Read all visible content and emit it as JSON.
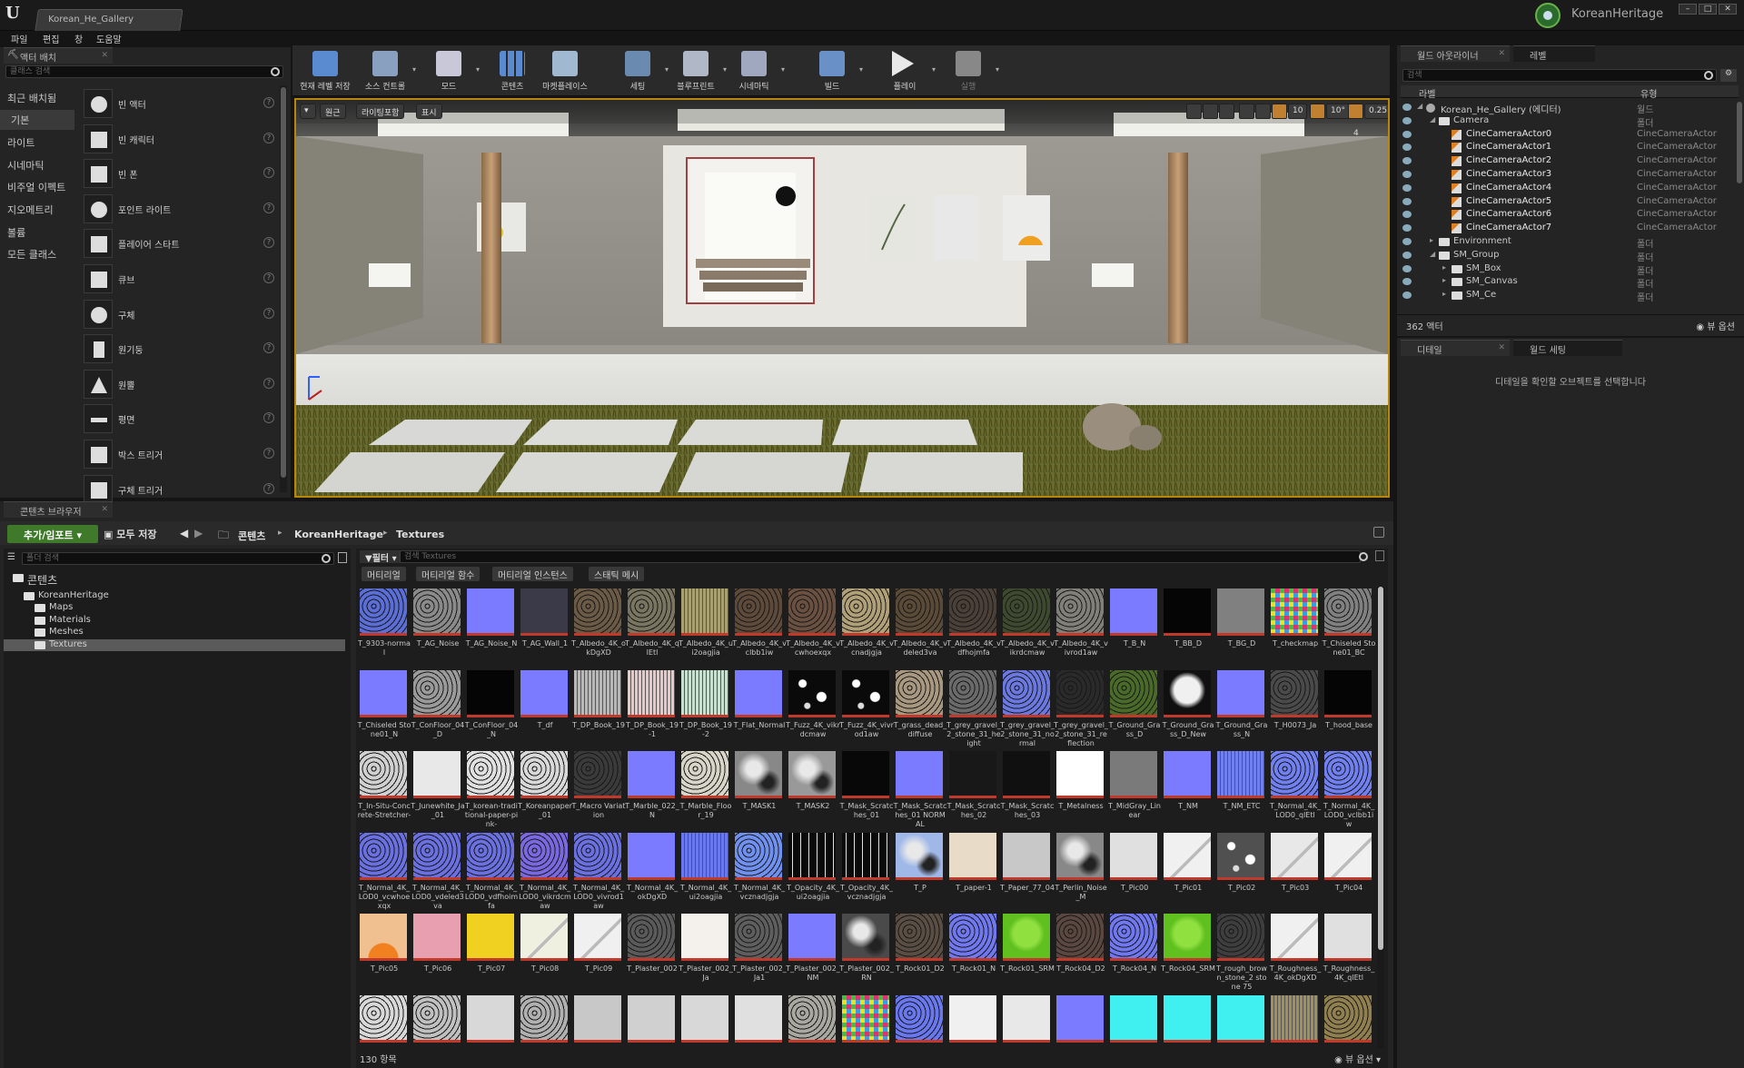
{
  "app": {
    "tab_title": "Korean_He_Gallery",
    "project_name": "KoreanHeritage"
  },
  "menu": [
    "파일",
    "편집",
    "창",
    "도움말"
  ],
  "place_actors": {
    "tab": "액터 배치",
    "search_placeholder": "클래스 검색",
    "categories": [
      "최근 배치됨",
      "기본",
      "라이트",
      "시네마틱",
      "비주얼 이펙트",
      "지오메트리",
      "볼륨",
      "모든 클래스"
    ],
    "active_category": "기본",
    "items": [
      "빈 액터",
      "빈 캐릭터",
      "빈 폰",
      "포인트 라이트",
      "플레이어 스타트",
      "큐브",
      "구체",
      "원기둥",
      "원뿔",
      "평면",
      "박스 트리거",
      "구체 트리거"
    ]
  },
  "toolbar": [
    {
      "label": "현재 레벨 저장",
      "icon": "save-icon",
      "caret": false
    },
    {
      "label": "소스 컨트롤",
      "icon": "source-control-icon",
      "caret": true
    },
    {
      "label": "모드",
      "icon": "modes-icon",
      "caret": true
    },
    {
      "label": "콘텐츠",
      "icon": "content-icon",
      "caret": false
    },
    {
      "label": "마켓플레이스",
      "icon": "marketplace-icon",
      "caret": false
    },
    {
      "label": "세팅",
      "icon": "settings-icon",
      "caret": true
    },
    {
      "label": "블루프린트",
      "icon": "blueprint-icon",
      "caret": true
    },
    {
      "label": "시네마틱",
      "icon": "cinematics-icon",
      "caret": true
    },
    {
      "label": "빌드",
      "icon": "build-icon",
      "caret": true
    },
    {
      "label": "플레이",
      "icon": "play-icon",
      "caret": true
    },
    {
      "label": "실행",
      "icon": "launch-icon",
      "caret": true
    }
  ],
  "viewport": {
    "perspective": "원근",
    "lit": "라이팅포함",
    "show": "표시",
    "grid_snap": "10",
    "rot_snap": "10°",
    "scale_snap": "0.25",
    "cam_speed": "4"
  },
  "outliner": {
    "tab": "월드 아웃라이너",
    "tab2": "레벨",
    "search_placeholder": "검색",
    "col_label": "라벨",
    "col_type": "유형",
    "rows": [
      {
        "label": "Korean_He_Gallery (에디터)",
        "type": "월드",
        "indent": 0,
        "icon": "world-icon"
      },
      {
        "label": "Camera",
        "type": "폴더",
        "indent": 1,
        "icon": "folder-icon"
      },
      {
        "label": "CineCameraActor0",
        "type": "CineCameraActor",
        "indent": 2,
        "icon": "camera-icon"
      },
      {
        "label": "CineCameraActor1",
        "type": "CineCameraActor",
        "indent": 2,
        "icon": "camera-icon"
      },
      {
        "label": "CineCameraActor2",
        "type": "CineCameraActor",
        "indent": 2,
        "icon": "camera-icon"
      },
      {
        "label": "CineCameraActor3",
        "type": "CineCameraActor",
        "indent": 2,
        "icon": "camera-icon"
      },
      {
        "label": "CineCameraActor4",
        "type": "CineCameraActor",
        "indent": 2,
        "icon": "camera-icon"
      },
      {
        "label": "CineCameraActor5",
        "type": "CineCameraActor",
        "indent": 2,
        "icon": "camera-icon"
      },
      {
        "label": "CineCameraActor6",
        "type": "CineCameraActor",
        "indent": 2,
        "icon": "camera-icon"
      },
      {
        "label": "CineCameraActor7",
        "type": "CineCameraActor",
        "indent": 2,
        "icon": "camera-icon"
      },
      {
        "label": "Environment",
        "type": "폴더",
        "indent": 1,
        "icon": "folder-icon"
      },
      {
        "label": "SM_Group",
        "type": "폴더",
        "indent": 1,
        "icon": "folder-icon"
      },
      {
        "label": "SM_Box",
        "type": "폴더",
        "indent": 2,
        "icon": "folder-icon"
      },
      {
        "label": "SM_Canvas",
        "type": "폴더",
        "indent": 2,
        "icon": "folder-icon"
      },
      {
        "label": "SM_Ce",
        "type": "폴더",
        "indent": 2,
        "icon": "folder-icon"
      }
    ],
    "actor_count": "362 액터",
    "view_options": "뷰 옵션"
  },
  "details": {
    "tab": "디테일",
    "tab2": "월드 세팅",
    "empty_msg": "디테일을 확인할 오브젝트를 선택합니다"
  },
  "content_browser": {
    "tab": "콘텐츠 브라우저",
    "import_btn": "추가/임포트",
    "save_all": "모두 저장",
    "crumbs": [
      "콘텐츠",
      "KoreanHeritage",
      "Textures"
    ],
    "folder_search": "폴더 검색",
    "filters_btn": "필터",
    "asset_search": "검색 Textures",
    "filter_tabs": [
      "머티리얼",
      "머티리얼 함수",
      "머티리얼 인스턴스",
      "스태틱 메시"
    ],
    "tree": [
      {
        "label": "콘텐츠",
        "indent": 0
      },
      {
        "label": "KoreanHeritage",
        "indent": 1
      },
      {
        "label": "Maps",
        "indent": 2
      },
      {
        "label": "Materials",
        "indent": 2
      },
      {
        "label": "Meshes",
        "indent": 2
      },
      {
        "label": "Textures",
        "indent": 2,
        "selected": true
      }
    ],
    "item_count": "130 항목",
    "view_options": "뷰 옵션",
    "assets": [
      {
        "name": "T_9303-normal",
        "c": "#5b6ed6",
        "tex": "noise"
      },
      {
        "name": "T_AG_Noise",
        "c": "#8a8a8a",
        "tex": "noise"
      },
      {
        "name": "T_AG_Noise_N",
        "c": "#7b7bff",
        "tex": "flat"
      },
      {
        "name": "T_AG_Wall_1",
        "c": "#3a3a48",
        "tex": "flat"
      },
      {
        "name": "T_Albedo_4K_okDgXD",
        "c": "#6b5a45",
        "tex": "noise"
      },
      {
        "name": "T_Albedo_4K_qlEtl",
        "c": "#7a7560",
        "tex": "noise"
      },
      {
        "name": "T_Albedo_4K_ui2oagjia",
        "c": "#a8a070",
        "tex": "stripes"
      },
      {
        "name": "T_Albedo_4K_vclbb1iw",
        "c": "#5e4a3a",
        "tex": "noise"
      },
      {
        "name": "T_Albedo_4K_vcwhoexqx",
        "c": "#6a5040",
        "tex": "noise"
      },
      {
        "name": "T_Albedo_4K_vcnadjgja",
        "c": "#b0a078",
        "tex": "noise"
      },
      {
        "name": "T_Albedo_4K_vdeled3va",
        "c": "#5a4a38",
        "tex": "noise"
      },
      {
        "name": "T_Albedo_4K_vdfhojmfa",
        "c": "#4a4038",
        "tex": "noise"
      },
      {
        "name": "T_Albedo_4K_vikrdcmaw",
        "c": "#3e4a30",
        "tex": "noise"
      },
      {
        "name": "T_Albedo_4K_vivrod1aw",
        "c": "#808078",
        "tex": "noise"
      },
      {
        "name": "T_B_N",
        "c": "#7b7bff",
        "tex": "flat"
      },
      {
        "name": "T_BB_D",
        "c": "#050505",
        "tex": "flat"
      },
      {
        "name": "T_BG_D",
        "c": "#808080",
        "tex": "flat"
      },
      {
        "name": "T_checkmap",
        "c": "#cc3399",
        "tex": "checker"
      },
      {
        "name": "T_Chiseled Stone01_BC",
        "c": "#808080",
        "tex": "noise"
      },
      {
        "name": "T_Chiseled Stone01_N",
        "c": "#7b7bff",
        "tex": "flat"
      },
      {
        "name": "T_ConFloor_04_D",
        "c": "#9a9a9a",
        "tex": "noise"
      },
      {
        "name": "T_ConFloor_04_N",
        "c": "#050505",
        "tex": "flat"
      },
      {
        "name": "T_df",
        "c": "#7b7bff",
        "tex": "flat"
      },
      {
        "name": "T_DP_Book_19",
        "c": "#b8b8b8",
        "tex": "stripes"
      },
      {
        "name": "T_DP_Book_19-1",
        "c": "#e6c8c8",
        "tex": "stripes"
      },
      {
        "name": "T_DP_Book_19-2",
        "c": "#c8e0d0",
        "tex": "stripes"
      },
      {
        "name": "T_Flat_Normal",
        "c": "#7b7bff",
        "tex": "flat"
      },
      {
        "name": "T_Fuzz_4K_vikrdcmaw",
        "c": "#0a0a0a",
        "tex": "spots"
      },
      {
        "name": "T_Fuzz_4K_vivrod1aw",
        "c": "#0a0a0a",
        "tex": "spots"
      },
      {
        "name": "T_grass_dead_diffuse",
        "c": "#a89880",
        "tex": "noise"
      },
      {
        "name": "T_grey_gravel_2_stone_31_height",
        "c": "#6a6a6a",
        "tex": "noise"
      },
      {
        "name": "T_grey_gravel_2_stone_31_normal",
        "c": "#6a78e0",
        "tex": "noise"
      },
      {
        "name": "T_grey_gravel_2_stone_31_reflection",
        "c": "#2a2a2a",
        "tex": "noise"
      },
      {
        "name": "T_Ground_Grass_D",
        "c": "#4a6a2a",
        "tex": "noise"
      },
      {
        "name": "T_Ground_Grass_D_New",
        "c": "#101010",
        "tex": "blob"
      },
      {
        "name": "T_Ground_Grass_N",
        "c": "#7b7bff",
        "tex": "flat"
      },
      {
        "name": "T_H0073_Ja",
        "c": "#4a4a4a",
        "tex": "noise"
      },
      {
        "name": "T_hood_base",
        "c": "#050505",
        "tex": "flat"
      },
      {
        "name": "T_In-Situ-Concrete-Stretcher-",
        "c": "#d0d0d0",
        "tex": "noise"
      },
      {
        "name": "T_Junewhite_Ja_01",
        "c": "#e8e8e8",
        "tex": "flat"
      },
      {
        "name": "T_korean-traditional-paper-pink-",
        "c": "#e0e0e0",
        "tex": "noise"
      },
      {
        "name": "T_Koreanpaper_01",
        "c": "#d8d8d8",
        "tex": "noise"
      },
      {
        "name": "T_Macro Variation",
        "c": "#3a3a3a",
        "tex": "noise"
      },
      {
        "name": "T_Marble_022_N",
        "c": "#7b7bff",
        "tex": "flat"
      },
      {
        "name": "T_Marble_Floor_19",
        "c": "#d8d4c8",
        "tex": "noise"
      },
      {
        "name": "T_MASK1",
        "c": "#888",
        "tex": "cloud"
      },
      {
        "name": "T_MASK2",
        "c": "#999",
        "tex": "cloud"
      },
      {
        "name": "T_Mask_Scratches_01",
        "c": "#080808",
        "tex": "flat"
      },
      {
        "name": "T_Mask_Scratches_01 NORMAL",
        "c": "#7b7bff",
        "tex": "flat"
      },
      {
        "name": "T_Mask_Scratches_02",
        "c": "#181818",
        "tex": "flat"
      },
      {
        "name": "T_Mask_Scratches_03",
        "c": "#101010",
        "tex": "flat"
      },
      {
        "name": "T_Metalness",
        "c": "#ffffff",
        "tex": "flat"
      },
      {
        "name": "T_MidGray_Linear",
        "c": "#7a7a7a",
        "tex": "flat"
      },
      {
        "name": "T_NM",
        "c": "#7b7bff",
        "tex": "flat"
      },
      {
        "name": "T_NM_ETC",
        "c": "#7080f0",
        "tex": "stripes"
      },
      {
        "name": "T_Normal_4K_LOD0_qlEtl",
        "c": "#7080f0",
        "tex": "noise"
      },
      {
        "name": "T_Normal_4K_LOD0_vclbb1iw",
        "c": "#7080f0",
        "tex": "noise"
      },
      {
        "name": "T_Normal_4K_LOD0_vcwhoexqx",
        "c": "#6a70e0",
        "tex": "noise"
      },
      {
        "name": "T_Normal_4K_LOD0_vdeled3va",
        "c": "#6a70e0",
        "tex": "noise"
      },
      {
        "name": "T_Normal_4K_LOD0_vdfhoimfa",
        "c": "#6a70e0",
        "tex": "noise"
      },
      {
        "name": "T_Normal_4K_LOD0_vikrdcmaw",
        "c": "#7a68e0",
        "tex": "noise"
      },
      {
        "name": "T_Normal_4K_LOD0_vivrod1aw",
        "c": "#6a70e0",
        "tex": "noise"
      },
      {
        "name": "T_Normal_4K_okDgXD",
        "c": "#7b7bff",
        "tex": "flat"
      },
      {
        "name": "T_Normal_4K_ui2oagjia",
        "c": "#6a78f0",
        "tex": "stripes"
      },
      {
        "name": "T_Normal_4K_vcznadjgja",
        "c": "#7090f0",
        "tex": "noise"
      },
      {
        "name": "T_Opacity_4K_ui2oagjia",
        "c": "#0a0a0a",
        "tex": "vstripes"
      },
      {
        "name": "T_Opacity_4K_vcznadjgja",
        "c": "#0a0a0a",
        "tex": "vstripes"
      },
      {
        "name": "T_P",
        "c": "#a0b8e8",
        "tex": "cloud"
      },
      {
        "name": "T_paper-1",
        "c": "#e8dcc8",
        "tex": "flat"
      },
      {
        "name": "T_Paper_77_04",
        "c": "#c8c8c8",
        "tex": "flat"
      },
      {
        "name": "T_Perlin_Noise_M",
        "c": "#888",
        "tex": "cloud"
      },
      {
        "name": "T_Pic00",
        "c": "#e0e0e0",
        "tex": "flat"
      },
      {
        "name": "T_Pic01",
        "c": "#f0f0f0",
        "tex": "pic"
      },
      {
        "name": "T_Pic02",
        "c": "#505050",
        "tex": "spots"
      },
      {
        "name": "T_Pic03",
        "c": "#e8e8e8",
        "tex": "pic"
      },
      {
        "name": "T_Pic04",
        "c": "#f0f0f0",
        "tex": "pic"
      },
      {
        "name": "T_Pic05",
        "c": "#f0c090",
        "tex": "sun"
      },
      {
        "name": "T_Pic06",
        "c": "#e8a0b0",
        "tex": "flat"
      },
      {
        "name": "T_Pic07",
        "c": "#f0d020",
        "tex": "flat"
      },
      {
        "name": "T_Pic08",
        "c": "#f0f0e0",
        "tex": "pic"
      },
      {
        "name": "T_Pic09",
        "c": "#f0f0f0",
        "tex": "pic"
      },
      {
        "name": "T_Plaster_002",
        "c": "#5a5a5a",
        "tex": "noise"
      },
      {
        "name": "T_Plaster_002_Ja",
        "c": "#f4f0ec",
        "tex": "flat"
      },
      {
        "name": "T_Plaster_002_Ja1",
        "c": "#5e5e5e",
        "tex": "noise"
      },
      {
        "name": "T_Plaster_002_NM",
        "c": "#7b7bff",
        "tex": "flat"
      },
      {
        "name": "T_Plaster_002_RN",
        "c": "#4a4a4a",
        "tex": "cloud"
      },
      {
        "name": "T_Rock01_D2",
        "c": "#5a4e44",
        "tex": "noise"
      },
      {
        "name": "T_Rock01_N",
        "c": "#7078f0",
        "tex": "noise"
      },
      {
        "name": "T_Rock01_SRM",
        "c": "#60c020",
        "tex": "blob"
      },
      {
        "name": "T_Rock04_D2",
        "c": "#5a4840",
        "tex": "noise"
      },
      {
        "name": "T_Rock04_N",
        "c": "#7078f0",
        "tex": "noise"
      },
      {
        "name": "T_Rock04_SRM",
        "c": "#60c020",
        "tex": "blob"
      },
      {
        "name": "T_rough_brown_stone_2 stone 75",
        "c": "#3e3e3e",
        "tex": "noise"
      },
      {
        "name": "T_Roughness_4K_okDgXD",
        "c": "#f0f0f0",
        "tex": "pic"
      },
      {
        "name": "T_Roughness_4K_qlEtl",
        "c": "#e0e0e0",
        "tex": "flat"
      },
      {
        "name": "",
        "c": "#d8d8d8",
        "tex": "noise"
      },
      {
        "name": "",
        "c": "#c0c0c0",
        "tex": "noise"
      },
      {
        "name": "",
        "c": "#d8d8d8",
        "tex": "flat"
      },
      {
        "name": "",
        "c": "#b0b0b0",
        "tex": "noise"
      },
      {
        "name": "",
        "c": "#c8c8c8",
        "tex": "flat"
      },
      {
        "name": "",
        "c": "#d0d0d0",
        "tex": "flat"
      },
      {
        "name": "",
        "c": "#d8d8d8",
        "tex": "flat"
      },
      {
        "name": "",
        "c": "#e0e0e0",
        "tex": "flat"
      },
      {
        "name": "",
        "c": "#a8a8a0",
        "tex": "noise"
      },
      {
        "name": "",
        "c": "#cc3399",
        "tex": "checker"
      },
      {
        "name": "",
        "c": "#6a78f0",
        "tex": "noise"
      },
      {
        "name": "",
        "c": "#f0f0f0",
        "tex": "flat"
      },
      {
        "name": "",
        "c": "#e8e8e8",
        "tex": "flat"
      },
      {
        "name": "",
        "c": "#7b7bff",
        "tex": "flat"
      },
      {
        "name": "",
        "c": "#40f0f0",
        "tex": "flat"
      },
      {
        "name": "",
        "c": "#40f0f0",
        "tex": "flat"
      },
      {
        "name": "",
        "c": "#40f0f0",
        "tex": "flat"
      },
      {
        "name": "",
        "c": "#a09060",
        "tex": "stripes"
      },
      {
        "name": "",
        "c": "#908050",
        "tex": "noise"
      }
    ]
  }
}
